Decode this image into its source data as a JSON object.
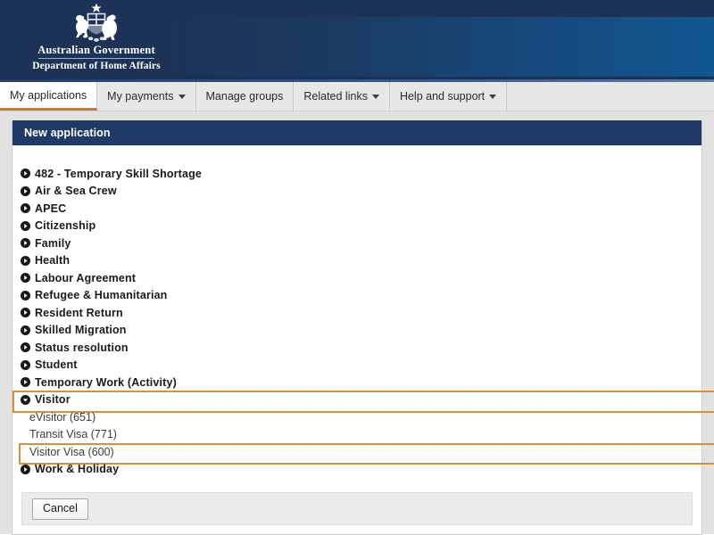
{
  "header": {
    "crest_icon": "australian-coat-of-arms",
    "line1": "Australian Government",
    "line2": "Department of Home Affairs",
    "bg_color": "#1d3257",
    "accent_color": "#11568f"
  },
  "nav": {
    "items": [
      {
        "label": "My applications",
        "has_caret": false,
        "active": true
      },
      {
        "label": "My payments",
        "has_caret": true,
        "active": false
      },
      {
        "label": "Manage groups",
        "has_caret": false,
        "active": false
      },
      {
        "label": "Related links",
        "has_caret": true,
        "active": false
      },
      {
        "label": "Help and support",
        "has_caret": true,
        "active": false
      }
    ],
    "active_underline_color": "#d87820"
  },
  "panel": {
    "title": "New application",
    "title_bg_color": "#1e3a66",
    "highlight_color": "#d98f3e"
  },
  "categories": [
    {
      "label": "482 - Temporary Skill Shortage",
      "icon": "circle-chevron-right-icon",
      "highlighted": false,
      "expanded": false
    },
    {
      "label": "Air & Sea Crew",
      "icon": "circle-chevron-right-icon",
      "highlighted": false,
      "expanded": false
    },
    {
      "label": "APEC",
      "icon": "circle-chevron-right-icon",
      "highlighted": false,
      "expanded": false
    },
    {
      "label": "Citizenship",
      "icon": "circle-chevron-right-icon",
      "highlighted": false,
      "expanded": false
    },
    {
      "label": "Family",
      "icon": "circle-chevron-right-icon",
      "highlighted": false,
      "expanded": false
    },
    {
      "label": "Health",
      "icon": "circle-chevron-right-icon",
      "highlighted": false,
      "expanded": false
    },
    {
      "label": "Labour Agreement",
      "icon": "circle-chevron-right-icon",
      "highlighted": false,
      "expanded": false
    },
    {
      "label": "Refugee & Humanitarian",
      "icon": "circle-chevron-right-icon",
      "highlighted": false,
      "expanded": false
    },
    {
      "label": "Resident Return",
      "icon": "circle-chevron-right-icon",
      "highlighted": false,
      "expanded": false
    },
    {
      "label": "Skilled Migration",
      "icon": "circle-chevron-right-icon",
      "highlighted": false,
      "expanded": false
    },
    {
      "label": "Status resolution",
      "icon": "circle-chevron-right-icon",
      "highlighted": false,
      "expanded": false
    },
    {
      "label": "Student",
      "icon": "circle-chevron-right-icon",
      "highlighted": false,
      "expanded": false
    },
    {
      "label": "Temporary Work (Activity)",
      "icon": "circle-chevron-right-icon",
      "highlighted": false,
      "expanded": false
    },
    {
      "label": "Visitor",
      "icon": "circle-chevron-down-icon",
      "highlighted": true,
      "expanded": true,
      "children": [
        {
          "label": "eVisitor (651)",
          "highlighted": false
        },
        {
          "label": "Transit Visa (771)",
          "highlighted": false
        },
        {
          "label": "Visitor Visa (600)",
          "highlighted": true
        }
      ]
    },
    {
      "label": "Work & Holiday",
      "icon": "circle-chevron-right-icon",
      "highlighted": false,
      "expanded": false
    }
  ],
  "footer": {
    "cancel_label": "Cancel"
  }
}
